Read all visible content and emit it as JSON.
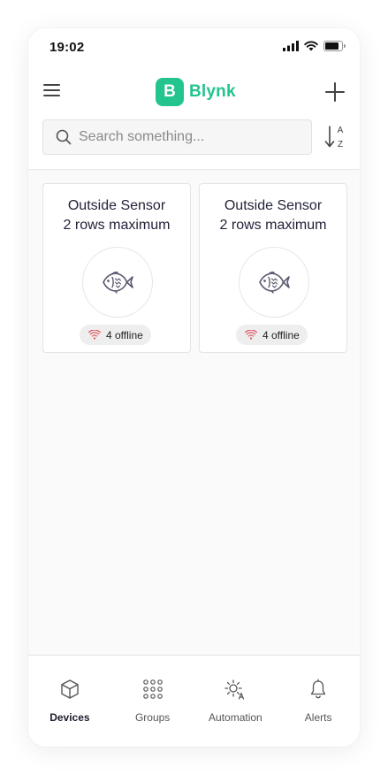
{
  "status_bar": {
    "time": "19:02"
  },
  "header": {
    "brand_letter": "B",
    "brand_name": "Blynk",
    "brand_color": "#23c48e"
  },
  "search": {
    "placeholder": "Search something...",
    "value": ""
  },
  "sort": {
    "top_letter": "A",
    "bottom_letter": "Z"
  },
  "devices": [
    {
      "title_line1": "Outside Sensor",
      "title_line2": "2 rows maximum",
      "icon": "fish-icon",
      "status": "4 offline"
    },
    {
      "title_line1": "Outside Sensor",
      "title_line2": "2 rows maximum",
      "icon": "fish-icon",
      "status": "4 offline"
    }
  ],
  "tabbar": {
    "tabs": [
      {
        "label": "Devices",
        "icon": "cube-icon",
        "active": true
      },
      {
        "label": "Groups",
        "icon": "grid-dots-icon",
        "active": false
      },
      {
        "label": "Automation",
        "icon": "sun-automation-icon",
        "active": false
      },
      {
        "label": "Alerts",
        "icon": "bell-icon",
        "active": false
      }
    ]
  },
  "colors": {
    "accent": "#23c48e",
    "offline": "#e0525a",
    "icon": "#5a5a70"
  }
}
